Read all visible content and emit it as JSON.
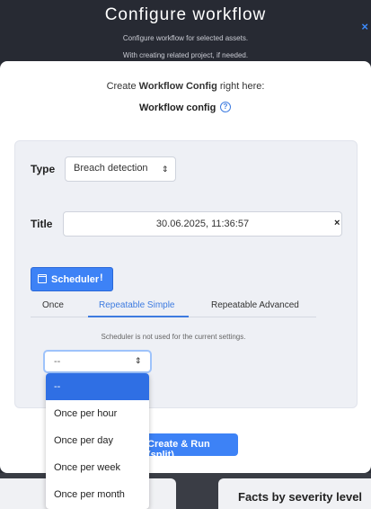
{
  "header": {
    "title": "Configure workflow",
    "subtitle_1": "Configure workflow for selected assets.",
    "subtitle_2": "With creating related project, if needed.",
    "close_glyph": "×"
  },
  "intro": {
    "prefix": "Create ",
    "bold": "Workflow Config",
    "suffix": " right here:"
  },
  "config_label": "Workflow config",
  "help_glyph": "?",
  "form": {
    "type_label": "Type",
    "type_value": "Breach detection",
    "title_label": "Title",
    "title_value": "30.06.2025, 11:36:57",
    "clear_glyph": "×",
    "sort_glyph": "⇕"
  },
  "scheduler": {
    "button_label": "Scheduler",
    "info_glyph": "!",
    "tabs": [
      "Once",
      "Repeatable Simple",
      "Repeatable Advanced"
    ],
    "active_tab": "Repeatable Simple",
    "note": "Scheduler is not used for the current settings.",
    "select_value": "--",
    "options": [
      "--",
      "Once per hour",
      "Once per day",
      "Once per week",
      "Once per month"
    ],
    "selected_option": "--"
  },
  "run_button": "Create & Run (split)",
  "background": {
    "card_title": "Facts by severity level"
  },
  "colors": {
    "accent": "#3d82f6",
    "header_bg": "#272a33",
    "panel_bg": "#eef0f5",
    "selected_option_bg": "#2f6fe4"
  },
  "icons": [
    "close-icon",
    "help-icon",
    "sort-icon",
    "clear-icon",
    "calendar-icon",
    "info-icon"
  ]
}
